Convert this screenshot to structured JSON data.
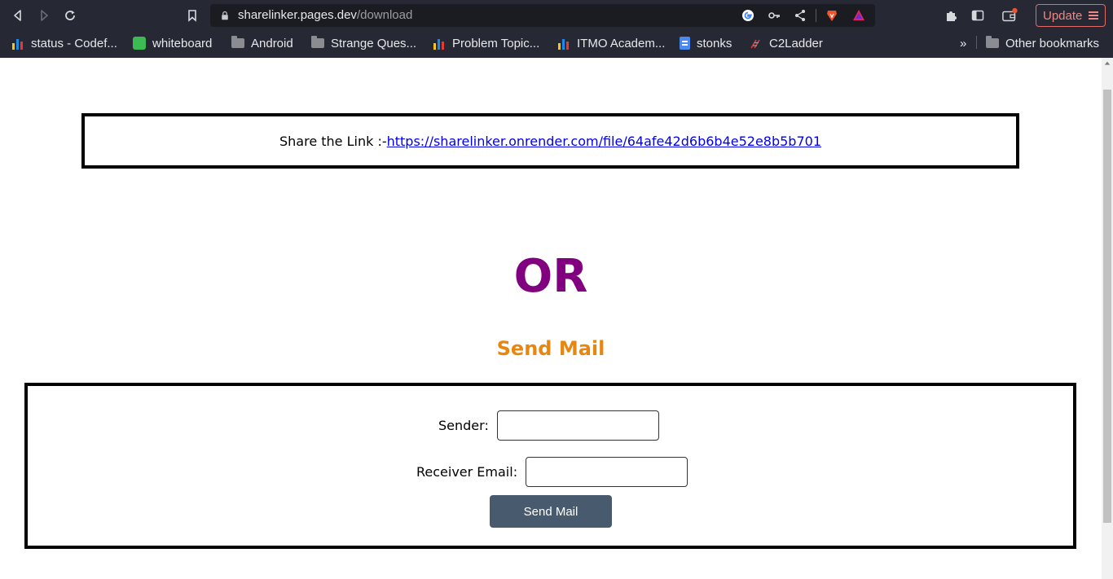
{
  "browser": {
    "url_host": "sharelinker.pages.dev",
    "url_path": "/download",
    "update_label": "Update",
    "bookmarks": [
      {
        "label": "status - Codef...",
        "icon": "bar-chart-icon"
      },
      {
        "label": "whiteboard",
        "icon": "whiteboard-icon"
      },
      {
        "label": "Android",
        "icon": "folder-icon"
      },
      {
        "label": "Strange Ques...",
        "icon": "folder-icon"
      },
      {
        "label": "Problem Topic...",
        "icon": "bar-chart-icon"
      },
      {
        "label": "ITMO Academ...",
        "icon": "bar-chart-icon"
      },
      {
        "label": "stonks",
        "icon": "doc-icon"
      },
      {
        "label": "C2Ladder",
        "icon": "ladder-icon"
      }
    ],
    "overflow_label": "»",
    "other_bookmarks": "Other bookmarks"
  },
  "page": {
    "share_prefix": "Share the Link :-",
    "share_link": "https://sharelinker.onrender.com/file/64afe42d6b6b4e52e8b5b701",
    "or_heading": "OR",
    "send_mail_heading": "Send Mail",
    "sender_label": "Sender:",
    "receiver_label": "Receiver Email:",
    "sender_value": "",
    "receiver_value": "",
    "send_button": "Send Mail"
  },
  "colors": {
    "chrome_bg": "#262833",
    "or_color": "#800080",
    "send_mail_color": "#e8870f",
    "button_bg": "#485a6e"
  }
}
